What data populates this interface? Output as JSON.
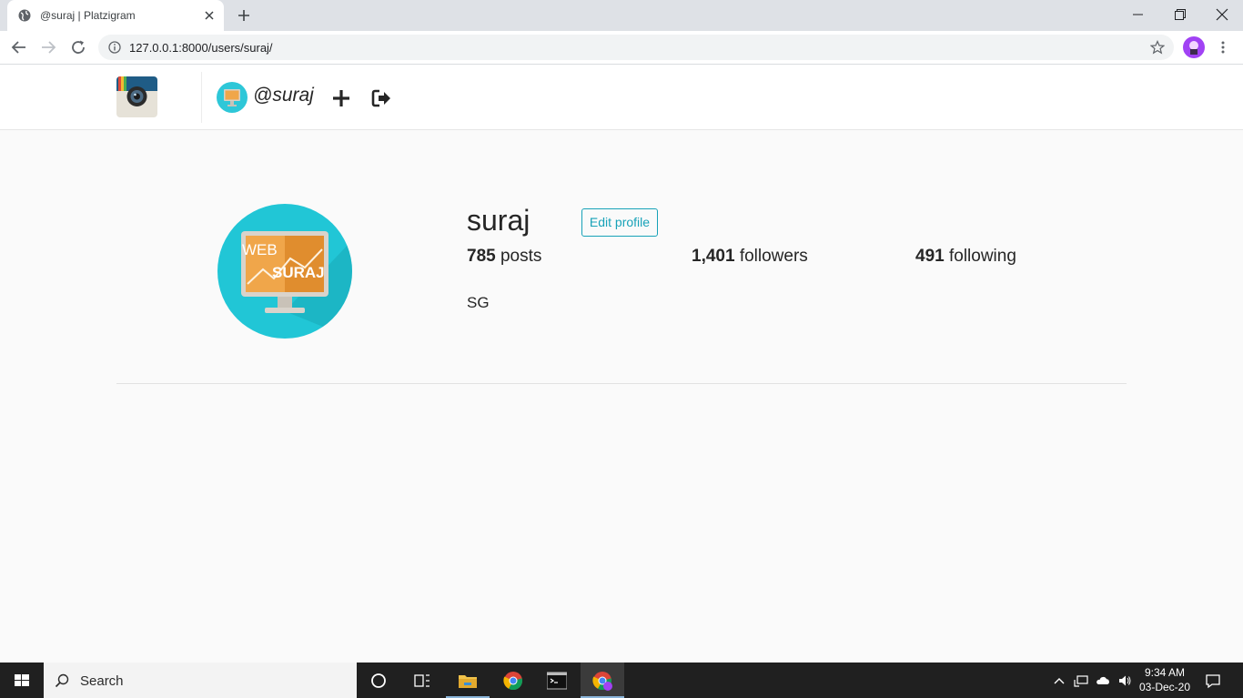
{
  "browser": {
    "tab_title": "@suraj | Platzigram",
    "url": "127.0.0.1:8000/users/suraj/"
  },
  "navbar": {
    "username": "@suraj"
  },
  "profile": {
    "name": "suraj",
    "edit_label": "Edit profile",
    "posts_count": "785",
    "posts_label": " posts",
    "followers_count": "1,401",
    "followers_label": " followers",
    "following_count": "491",
    "following_label": " following",
    "bio": "SG",
    "avatar_text_1": "WEB",
    "avatar_text_2": "SURAJ"
  },
  "taskbar": {
    "search_placeholder": "Search",
    "time": "9:34 AM",
    "date": "03-Dec-20"
  },
  "colors": {
    "accent": "#17a2b8",
    "avatar_bg": "#21c6d6"
  }
}
